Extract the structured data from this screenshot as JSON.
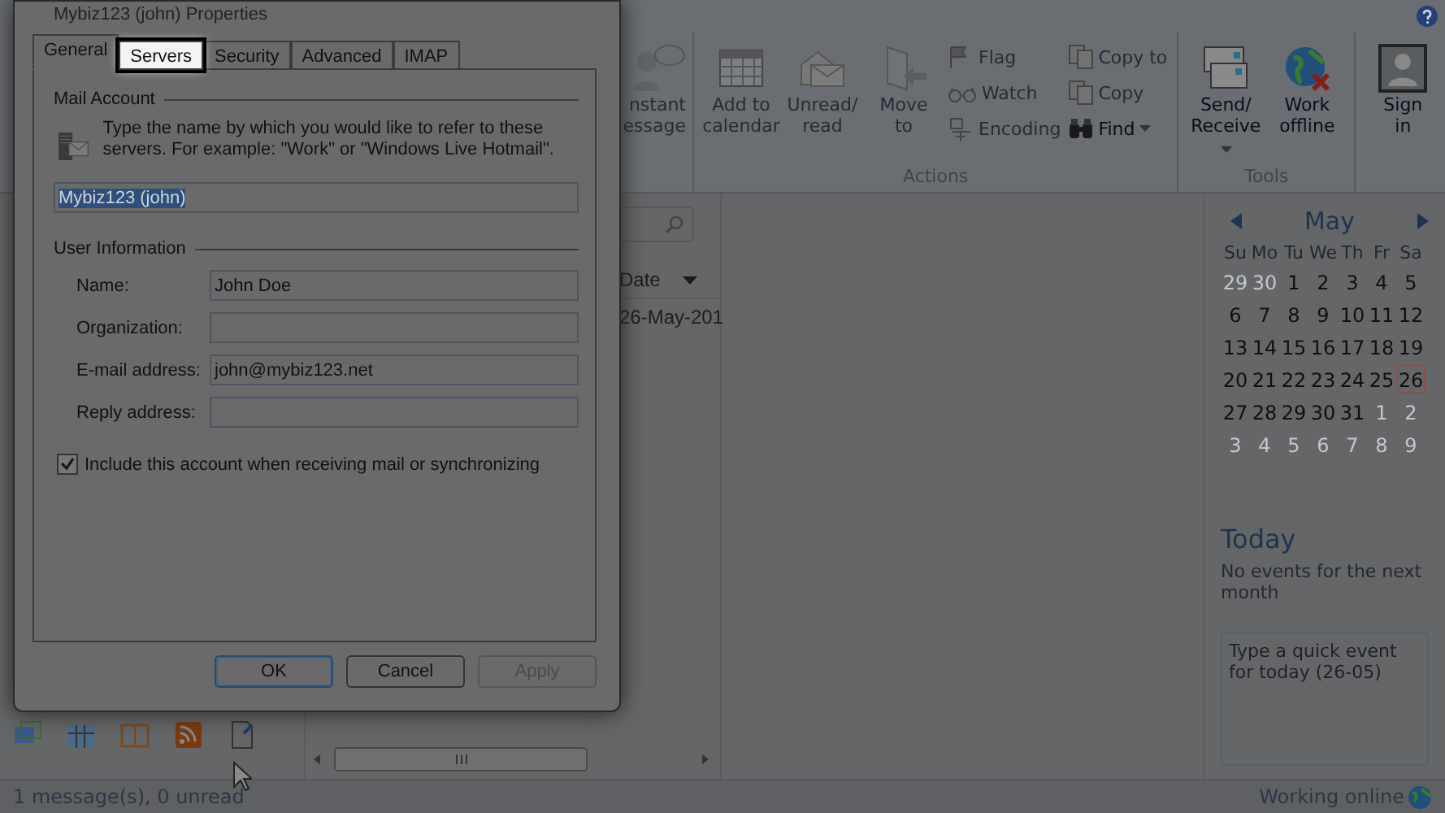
{
  "dialog": {
    "title": "Mybiz123 (john) Properties",
    "tabs": [
      {
        "label": "General",
        "selected": true,
        "highlighted": false
      },
      {
        "label": "Servers",
        "selected": false,
        "highlighted": true
      },
      {
        "label": "Security",
        "selected": false,
        "highlighted": false
      },
      {
        "label": "Advanced",
        "selected": false,
        "highlighted": false
      },
      {
        "label": "IMAP",
        "selected": false,
        "highlighted": false
      }
    ],
    "mail_account": {
      "heading": "Mail Account",
      "description": "Type the name by which you would like to refer to these servers.  For example: \"Work\" or \"Windows Live Hotmail\".",
      "account_name": {
        "value": "Mybiz123 (john)",
        "selected": true
      }
    },
    "user_information": {
      "heading": "User Information",
      "fields": [
        {
          "label": "Name:",
          "value": "John Doe"
        },
        {
          "label": "Organization:"
        },
        {
          "label": "E-mail address:",
          "value": "john@mybiz123.net"
        },
        {
          "label": "Reply address:"
        }
      ]
    },
    "include_account": {
      "label": "Include this account when receiving mail or synchronizing",
      "checked": true
    },
    "buttons": [
      {
        "label": "OK",
        "kind": "default",
        "disabled": false
      },
      {
        "label": "Cancel",
        "kind": "normal",
        "disabled": false
      },
      {
        "label": "Apply",
        "kind": "normal",
        "disabled": true
      }
    ]
  },
  "ribbon": {
    "partial_button": {
      "lines": [
        "nstant",
        "essage"
      ],
      "disabled": true
    },
    "groups": [
      {
        "label": "Actions",
        "big_buttons": [
          {
            "lines": [
              "Add to",
              "calendar"
            ],
            "disabled": true,
            "caret": false
          },
          {
            "lines": [
              "Unread/",
              "read"
            ],
            "disabled": true,
            "caret": false
          },
          {
            "lines": [
              "Move",
              "to"
            ],
            "disabled": true,
            "caret": false
          }
        ],
        "small_buttons": [
          {
            "label": "Flag",
            "disabled": true,
            "caret": false
          },
          {
            "label": "Watch",
            "disabled": true,
            "caret": false
          },
          {
            "label": "Encoding",
            "disabled": true,
            "caret": false
          },
          {
            "label": "Copy to",
            "disabled": true,
            "caret": false
          },
          {
            "label": "Copy",
            "disabled": true,
            "caret": false
          },
          {
            "label": "Find",
            "disabled": false,
            "caret": true
          }
        ]
      },
      {
        "label": "Tools",
        "big_buttons": [
          {
            "lines": [
              "Send/",
              "Receive"
            ],
            "disabled": false,
            "caret": true
          },
          {
            "lines": [
              "Work",
              "offline"
            ],
            "disabled": false,
            "caret": false
          }
        ]
      },
      {
        "big_buttons": [
          {
            "lines": [
              "Sign",
              "in"
            ],
            "disabled": false,
            "caret": false
          }
        ]
      }
    ]
  },
  "message_list": {
    "columns": [
      {
        "label": "Date"
      }
    ],
    "rows": [
      {
        "date": "26-May-201"
      }
    ]
  },
  "calendar": {
    "month": "May",
    "weekdays": [
      "Su",
      "Mo",
      "Tu",
      "We",
      "Th",
      "Fr",
      "Sa"
    ],
    "weeks": [
      [
        {
          "day": "29",
          "muted": true,
          "selected": false
        },
        {
          "day": "30",
          "muted": true,
          "selected": false
        },
        {
          "day": "1",
          "muted": false,
          "selected": false
        },
        {
          "day": "2",
          "muted": false,
          "selected": false
        },
        {
          "day": "3",
          "muted": false,
          "selected": false
        },
        {
          "day": "4",
          "muted": false,
          "selected": false
        },
        {
          "day": "5",
          "muted": false,
          "selected": false
        }
      ],
      [
        {
          "day": "6",
          "muted": false,
          "selected": false
        },
        {
          "day": "7",
          "muted": false,
          "selected": false
        },
        {
          "day": "8",
          "muted": false,
          "selected": false
        },
        {
          "day": "9",
          "muted": false,
          "selected": false
        },
        {
          "day": "10",
          "muted": false,
          "selected": false
        },
        {
          "day": "11",
          "muted": false,
          "selected": false
        },
        {
          "day": "12",
          "muted": false,
          "selected": false
        }
      ],
      [
        {
          "day": "13",
          "muted": false,
          "selected": false
        },
        {
          "day": "14",
          "muted": false,
          "selected": false
        },
        {
          "day": "15",
          "muted": false,
          "selected": false
        },
        {
          "day": "16",
          "muted": false,
          "selected": false
        },
        {
          "day": "17",
          "muted": false,
          "selected": false
        },
        {
          "day": "18",
          "muted": false,
          "selected": false
        },
        {
          "day": "19",
          "muted": false,
          "selected": false
        }
      ],
      [
        {
          "day": "20",
          "muted": false,
          "selected": false
        },
        {
          "day": "21",
          "muted": false,
          "selected": false
        },
        {
          "day": "22",
          "muted": false,
          "selected": false
        },
        {
          "day": "23",
          "muted": false,
          "selected": false
        },
        {
          "day": "24",
          "muted": false,
          "selected": false
        },
        {
          "day": "25",
          "muted": false,
          "selected": false
        },
        {
          "day": "26",
          "muted": false,
          "selected": true
        }
      ],
      [
        {
          "day": "27",
          "muted": false,
          "selected": false
        },
        {
          "day": "28",
          "muted": false,
          "selected": false
        },
        {
          "day": "29",
          "muted": false,
          "selected": false
        },
        {
          "day": "30",
          "muted": false,
          "selected": false
        },
        {
          "day": "31",
          "muted": false,
          "selected": false
        },
        {
          "day": "1",
          "muted": true,
          "selected": false
        },
        {
          "day": "2",
          "muted": true,
          "selected": false
        }
      ],
      [
        {
          "day": "3",
          "muted": true,
          "selected": false
        },
        {
          "day": "4",
          "muted": true,
          "selected": false
        },
        {
          "day": "5",
          "muted": true,
          "selected": false
        },
        {
          "day": "6",
          "muted": true,
          "selected": false
        },
        {
          "day": "7",
          "muted": true,
          "selected": false
        },
        {
          "day": "8",
          "muted": true,
          "selected": false
        },
        {
          "day": "9",
          "muted": true,
          "selected": false
        }
      ]
    ],
    "today": {
      "heading": "Today",
      "message": "No events for the next month",
      "quick_event": {
        "placeholder": "Type a quick event for today (26-05)"
      }
    }
  },
  "status_bar": {
    "messages": "1 message(s), 0 unread",
    "connection": "Working online"
  }
}
